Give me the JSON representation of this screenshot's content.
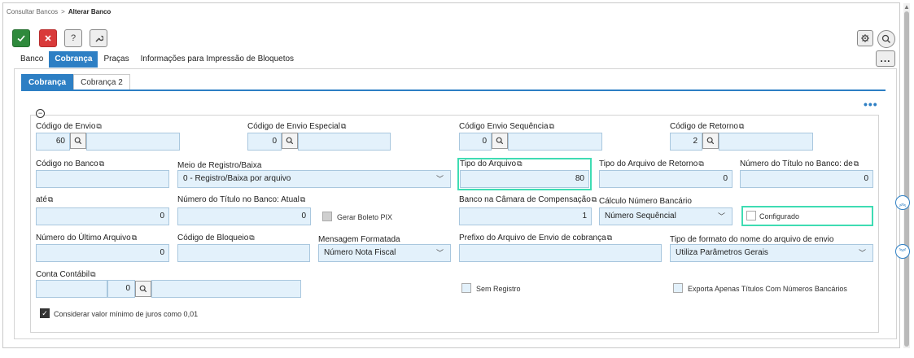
{
  "breadcrumb": {
    "parent": "Consultar Bancos",
    "separator": ">",
    "current": "Alterar Banco"
  },
  "toolbar": {
    "confirm_icon": "check-icon",
    "cancel_icon": "close-icon",
    "help_label": "?",
    "tools_icon": "wrench-icon",
    "settings_icon": "gear-icon",
    "search_icon": "search-icon",
    "more_label": "..."
  },
  "main_tabs": [
    {
      "label": "Banco",
      "active": false
    },
    {
      "label": "Cobrança",
      "active": true
    },
    {
      "label": "Praças",
      "active": false
    },
    {
      "label": "Informações para Impressão de Bloquetos",
      "active": false
    }
  ],
  "sub_tabs": [
    {
      "label": "Cobrança",
      "active": true
    },
    {
      "label": "Cobrança 2",
      "active": false
    }
  ],
  "section": {
    "more_label": "•••",
    "collapse_icon": "minus-circle-icon"
  },
  "fields": {
    "codigo_envio": {
      "label": "Código de Envio",
      "value": "60"
    },
    "codigo_envio_especial": {
      "label": "Código de Envio Especial",
      "value": "0"
    },
    "codigo_envio_sequencia": {
      "label": "Código Envio Sequência",
      "value": "0"
    },
    "codigo_retorno": {
      "label": "Código de Retorno",
      "value": "2"
    },
    "codigo_no_banco": {
      "label": "Código no Banco",
      "value": ""
    },
    "meio_registro": {
      "label": "Meio de Registro/Baixa",
      "value": "0 - Registro/Baixa por arquivo"
    },
    "tipo_arquivo": {
      "label": "Tipo do Arquivo",
      "value": "80"
    },
    "tipo_arquivo_retorno": {
      "label": "Tipo do Arquivo de Retorno",
      "value": "0"
    },
    "numero_titulo_de": {
      "label": "Número do Título no Banco: de",
      "value": "0"
    },
    "ate": {
      "label": "até",
      "value": "0"
    },
    "numero_titulo_atual": {
      "label": "Número do Título no Banco: Atual",
      "value": "0"
    },
    "gerar_boleto_pix": {
      "label": "Gerar Boleto PIX"
    },
    "banco_camara": {
      "label": "Banco na Câmara de Compensação",
      "value": "1"
    },
    "calculo_numero": {
      "label": "Cálculo Número Bancário",
      "value": "Número Sequêncial"
    },
    "configurado": {
      "label": "Configurado"
    },
    "numero_ultimo_arquivo": {
      "label": "Número do Último Arquivo",
      "value": "0"
    },
    "codigo_bloqueio": {
      "label": "Código de Bloqueio",
      "value": ""
    },
    "mensagem_formatada": {
      "label": "Mensagem Formatada",
      "value": "Número Nota Fiscal"
    },
    "prefixo_arquivo": {
      "label": "Prefixo do Arquivo de Envio de cobrança",
      "value": ""
    },
    "tipo_formato_nome": {
      "label": "Tipo de formato do nome do arquivo de envio",
      "value": "Utiliza Parâmetros Gerais"
    },
    "conta_contabil": {
      "label": "Conta Contábil",
      "value": "0"
    },
    "sem_registro": {
      "label": "Sem Registro"
    },
    "exporta_apenas": {
      "label": "Exporta Apenas Títulos Com Números Bancários"
    },
    "considerar_juros": {
      "label": "Considerar valor mínimo de juros como 0,01",
      "checked": true
    }
  },
  "colors": {
    "accent": "#2d7fc4",
    "field_bg": "#e3f1fb",
    "highlight": "#3fdcb3",
    "confirm": "#2f8a3c",
    "cancel": "#d93a3a"
  }
}
